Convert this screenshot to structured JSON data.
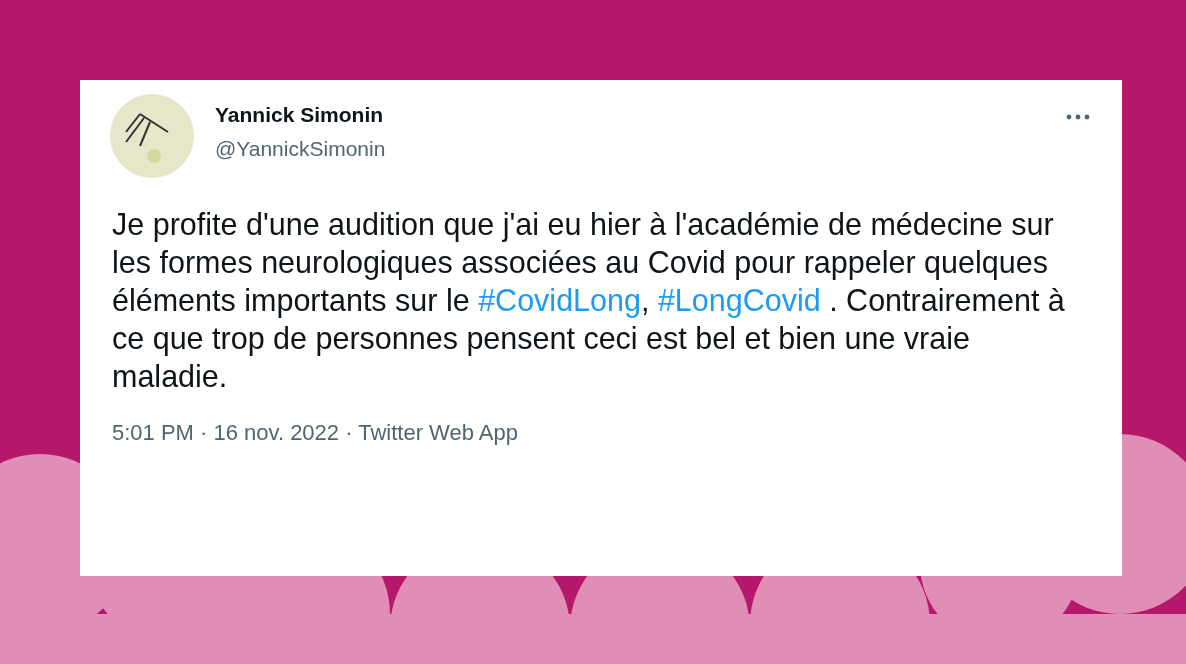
{
  "tweet": {
    "author": {
      "name": "Yannick Simonin",
      "handle": "@YannickSimonin"
    },
    "text": [
      {
        "kind": "text",
        "value": "Je profite d'une audition que j'ai eu hier à l'académie de médecine sur les formes neurologiques associées au Covid pour rappeler quelques éléments importants sur le "
      },
      {
        "kind": "hashtag",
        "value": "#CovidLong"
      },
      {
        "kind": "text",
        "value": ", "
      },
      {
        "kind": "hashtag",
        "value": "#LongCovid"
      },
      {
        "kind": "text",
        "value": " . Contrairement à ce que trop de personnes pensent ceci est bel et bien une vraie maladie."
      }
    ],
    "meta": "5:01 PM · 16 nov. 2022 · Twitter Web App"
  }
}
